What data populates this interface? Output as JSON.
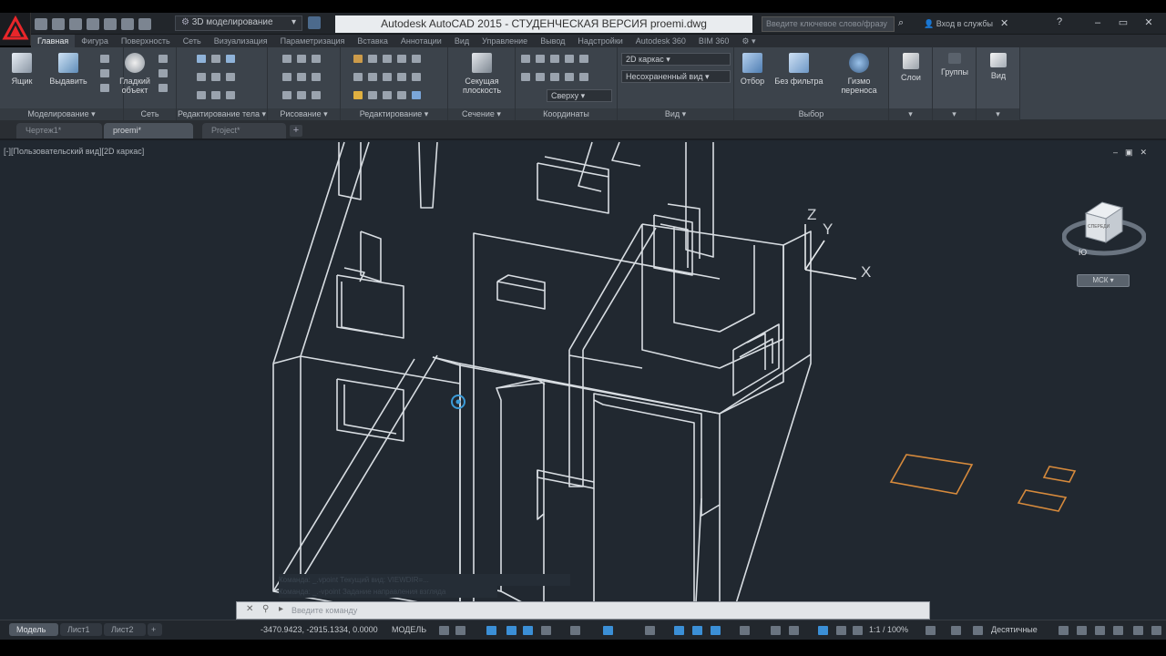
{
  "app": {
    "title": "Autodesk AutoCAD 2015 - СТУДЕНЧЕСКАЯ ВЕРСИЯ    proemi.dwg",
    "logo_letter": "A",
    "workspace": "3D моделирование",
    "search_placeholder": "Введите ключевое слово/фразу",
    "signin": "Вход в службы",
    "accent": "#e8262a"
  },
  "ribbon_tabs": [
    "Главная",
    "Фигура",
    "Поверхность",
    "Сеть",
    "Визуализация",
    "Параметризация",
    "Вставка",
    "Аннотации",
    "Вид",
    "Управление",
    "Вывод",
    "Надстройки",
    "Autodesk 360",
    "BIM 360",
    "⚙ ▾"
  ],
  "ribbon": {
    "panels": {
      "modeling": "Моделирование ▾",
      "mesh": "Сеть",
      "solid_edit": "Редактирование тела ▾",
      "draw": "Рисование ▾",
      "modify": "Редактирование ▾",
      "section": "Сечение ▾",
      "coordinates": "Координаты",
      "view": "Вид ▾",
      "selection": "Выбор"
    },
    "buttons": {
      "box": "Ящик",
      "extrude": "Выдавить",
      "smooth_object": "Гладкий объект",
      "section_plane": "Секущая плоскость",
      "visual_style": "2D каркас",
      "view": "Несохраненный вид",
      "ucs": "Сверху",
      "culling": "Отбор",
      "no_filter": "Без фильтра",
      "gizmo": "Гизмо переноса",
      "layers": "Слои",
      "groups": "Группы",
      "view_btn": "Вид"
    }
  },
  "file_tabs": [
    "Чертеж1*",
    "proemi*",
    "Project*"
  ],
  "viewport": {
    "label": "[-][Пользовательский вид][2D каркас]",
    "viewcube_face": "СПЕРЕДИ",
    "viewcube_compass": "Ю",
    "wcs": "МСК ▾",
    "axis_x": "X",
    "axis_y": "Y",
    "axis_z": "Z"
  },
  "command_line": {
    "history_1": "Команда: _.vpoint Текущий вид: VIEWDIR=...",
    "history_2": "Команда: _.-vpoint Задание направления взгляда",
    "input_placeholder": "Введите команду"
  },
  "layout_tabs": [
    "Модель",
    "Лист1",
    "Лист2"
  ],
  "status": {
    "coords": "-3470.9423, -2915.1334, 0.0000",
    "mode": "МОДЕЛЬ",
    "scale": "1:1 / 100%",
    "units": "Десятичные"
  }
}
